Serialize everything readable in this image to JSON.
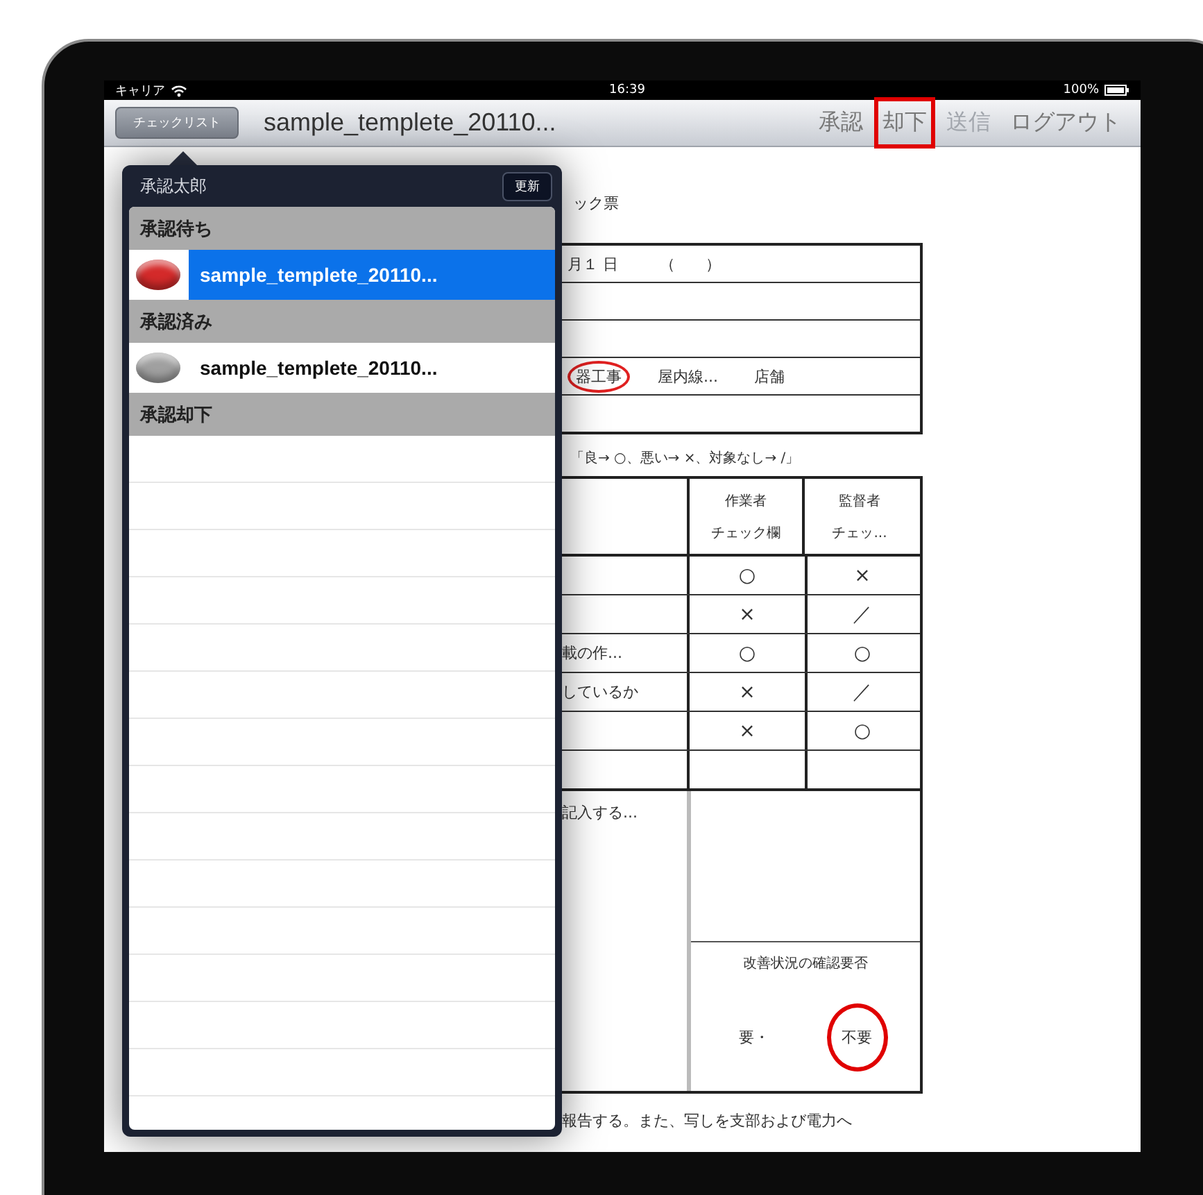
{
  "status_bar": {
    "carrier": "キャリア",
    "time": "16:39",
    "battery": "100%"
  },
  "nav": {
    "back_button": "チェックリスト",
    "title": "sample_templete_20110...",
    "actions": [
      {
        "label": "承認",
        "disabled": false,
        "highlighted": false
      },
      {
        "label": "却下",
        "disabled": false,
        "highlighted": true
      },
      {
        "label": "送信",
        "disabled": true,
        "highlighted": false
      },
      {
        "label": "ログアウト",
        "disabled": false,
        "highlighted": false
      }
    ]
  },
  "document": {
    "title_fragment": "ック票",
    "date_row": [
      "月１ 日",
      "（　　）"
    ],
    "category_row": [
      {
        "text": "器工事",
        "circled": true
      },
      {
        "text": "屋内線...",
        "circled": false
      },
      {
        "text": "店舗",
        "circled": false
      }
    ],
    "legend": "「良→ ○、悪い→ ×、対象なし→ /」",
    "check_table": {
      "columns": [
        {
          "line1": "作業者",
          "line2": "チェック欄"
        },
        {
          "line1": "監督者",
          "line2": "チェッ..."
        }
      ],
      "rows": [
        {
          "item": "",
          "worker": "○",
          "supervisor": "×"
        },
        {
          "item": "",
          "worker": "×",
          "supervisor": "／"
        },
        {
          "item": "載の作...",
          "worker": "○",
          "supervisor": "○"
        },
        {
          "item": "しているか",
          "worker": "×",
          "supervisor": "／"
        },
        {
          "item": "",
          "worker": "×",
          "supervisor": "○"
        },
        {
          "item": "",
          "worker": "",
          "supervisor": ""
        }
      ]
    },
    "remarks": "記入する...",
    "confirm": {
      "label": "改善状況の確認要否",
      "options": [
        {
          "text": "要・",
          "circled": false
        },
        {
          "text": "不要",
          "circled": true
        }
      ]
    },
    "footer": "報告する。また、写しを支部および電力へ"
  },
  "popover": {
    "user": "承認太郎",
    "refresh_button": "更新",
    "sections": [
      {
        "header": "承認待ち",
        "items": [
          {
            "name": "sample_templete_20110...",
            "color": "#d42a2a",
            "selected": true
          }
        ]
      },
      {
        "header": "承認済み",
        "items": [
          {
            "name": "sample_templete_20110...",
            "color": "#a0a0a0",
            "selected": false
          }
        ]
      },
      {
        "header": "承認却下"
      }
    ]
  }
}
